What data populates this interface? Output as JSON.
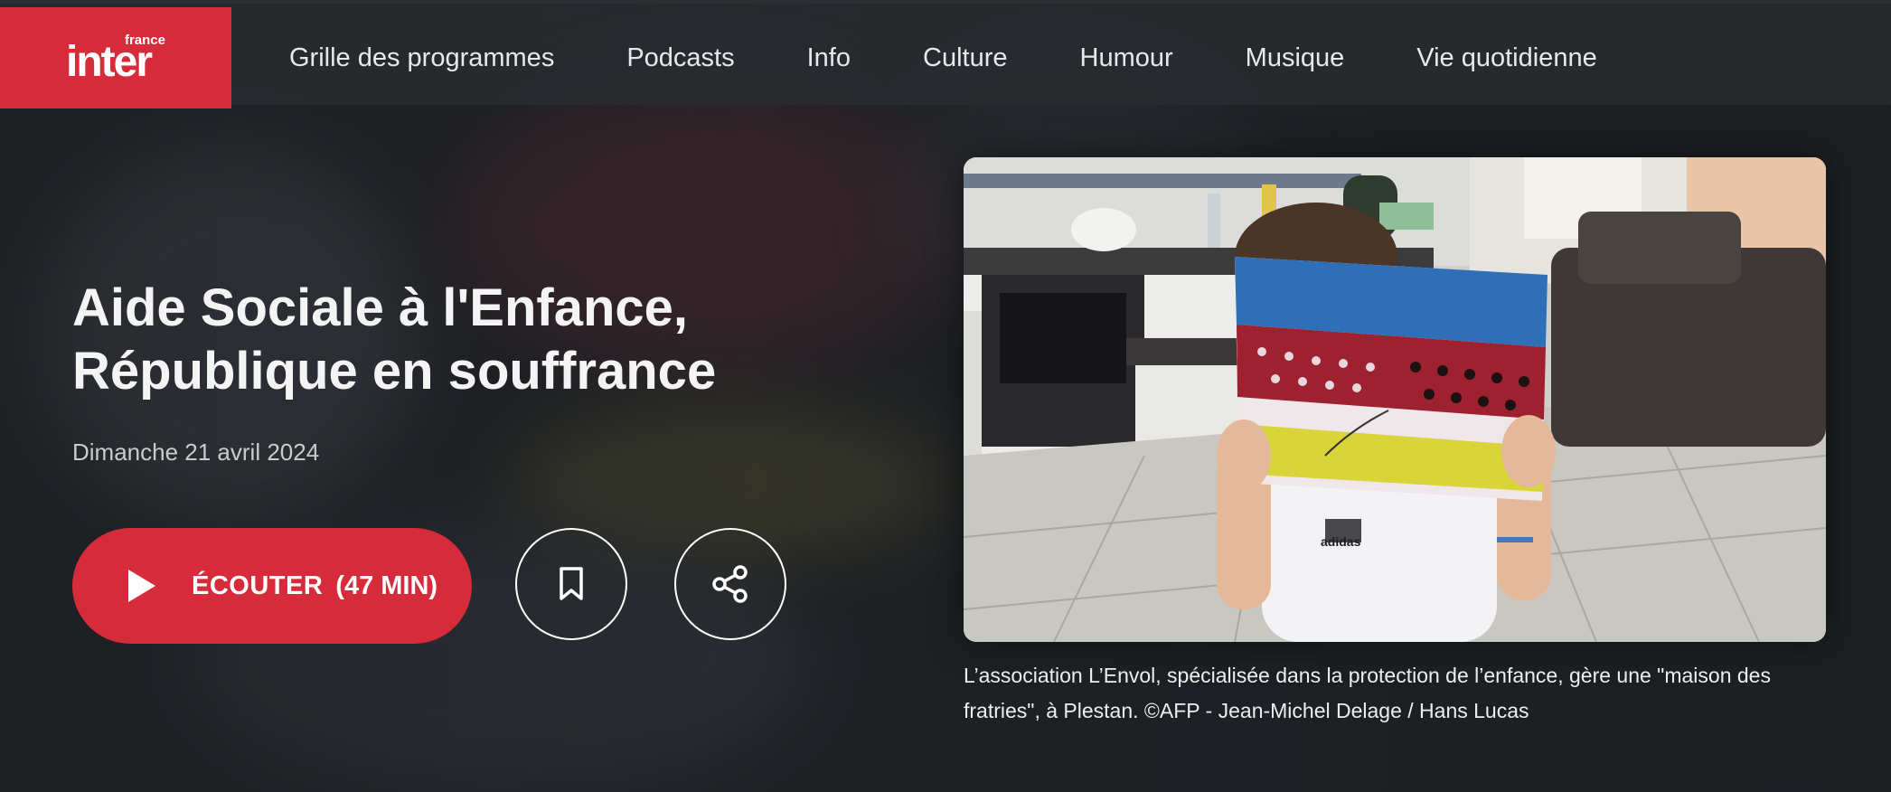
{
  "brand": {
    "logo_small": "france",
    "logo_big": "inter",
    "accent": "#d52b3a"
  },
  "nav": {
    "items": [
      {
        "label": "Grille des programmes"
      },
      {
        "label": "Podcasts"
      },
      {
        "label": "Info"
      },
      {
        "label": "Culture"
      },
      {
        "label": "Humour"
      },
      {
        "label": "Musique"
      },
      {
        "label": "Vie quotidienne"
      }
    ]
  },
  "episode": {
    "title": "Aide Sociale à l'Enfance, République en souffrance",
    "date": "Dimanche 21 avril 2024",
    "listen_label": "ÉCOUTER",
    "listen_duration": "(47 MIN)",
    "play_icon": "play-icon",
    "bookmark_icon": "bookmark-icon",
    "share_icon": "share-icon"
  },
  "image": {
    "caption": "L’association L’Envol, spécialisée dans la protection de l’enfance, gère une \"maison des fratries\", à Plestan. ©AFP - Jean-Michel Delage / Hans Lucas",
    "shirt_brand": "adidas"
  }
}
